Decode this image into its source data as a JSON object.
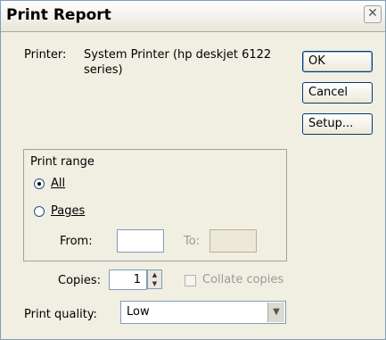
{
  "window": {
    "title": "Print Report",
    "close_glyph": "✕"
  },
  "printer": {
    "label": "Printer:",
    "line1": "System Printer (hp deskjet 6122",
    "line2": "series)"
  },
  "buttons": {
    "ok": "OK",
    "cancel": "Cancel",
    "setup": "Setup..."
  },
  "print_range": {
    "legend": "Print range",
    "all_label": "All",
    "pages_label": "Pages",
    "selected": "All",
    "from_label": "From:",
    "to_label": "To:",
    "from_value": "",
    "to_value": ""
  },
  "copies": {
    "label": "Copies:",
    "value": "1",
    "collate_label": "Collate copies",
    "collate_checked": false,
    "collate_enabled": false
  },
  "quality": {
    "label": "Print quality:",
    "value": "Low"
  }
}
